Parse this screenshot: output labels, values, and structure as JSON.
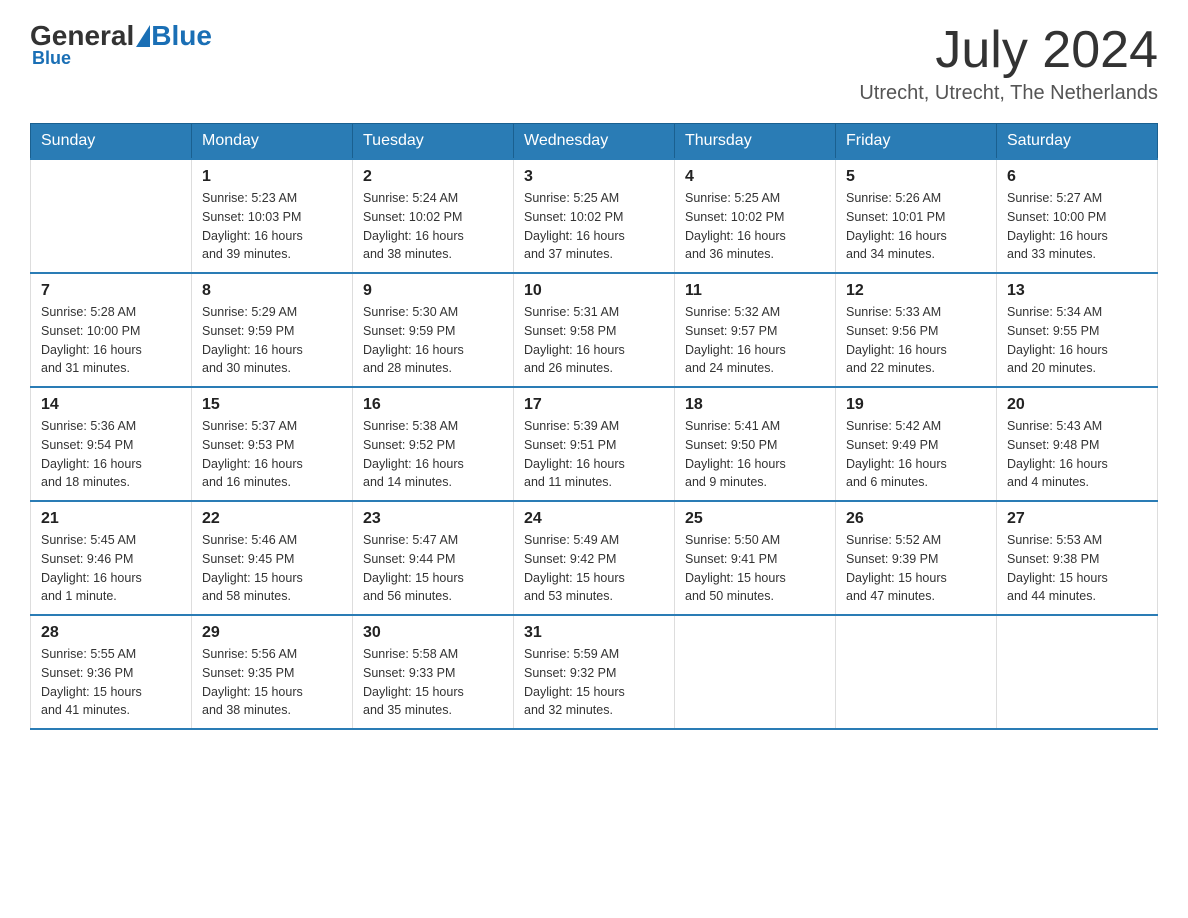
{
  "header": {
    "logo_general": "General",
    "logo_blue": "Blue",
    "month_year": "July 2024",
    "location": "Utrecht, Utrecht, The Netherlands"
  },
  "weekdays": [
    "Sunday",
    "Monday",
    "Tuesday",
    "Wednesday",
    "Thursday",
    "Friday",
    "Saturday"
  ],
  "weeks": [
    [
      {
        "day": "",
        "info": ""
      },
      {
        "day": "1",
        "info": "Sunrise: 5:23 AM\nSunset: 10:03 PM\nDaylight: 16 hours\nand 39 minutes."
      },
      {
        "day": "2",
        "info": "Sunrise: 5:24 AM\nSunset: 10:02 PM\nDaylight: 16 hours\nand 38 minutes."
      },
      {
        "day": "3",
        "info": "Sunrise: 5:25 AM\nSunset: 10:02 PM\nDaylight: 16 hours\nand 37 minutes."
      },
      {
        "day": "4",
        "info": "Sunrise: 5:25 AM\nSunset: 10:02 PM\nDaylight: 16 hours\nand 36 minutes."
      },
      {
        "day": "5",
        "info": "Sunrise: 5:26 AM\nSunset: 10:01 PM\nDaylight: 16 hours\nand 34 minutes."
      },
      {
        "day": "6",
        "info": "Sunrise: 5:27 AM\nSunset: 10:00 PM\nDaylight: 16 hours\nand 33 minutes."
      }
    ],
    [
      {
        "day": "7",
        "info": "Sunrise: 5:28 AM\nSunset: 10:00 PM\nDaylight: 16 hours\nand 31 minutes."
      },
      {
        "day": "8",
        "info": "Sunrise: 5:29 AM\nSunset: 9:59 PM\nDaylight: 16 hours\nand 30 minutes."
      },
      {
        "day": "9",
        "info": "Sunrise: 5:30 AM\nSunset: 9:59 PM\nDaylight: 16 hours\nand 28 minutes."
      },
      {
        "day": "10",
        "info": "Sunrise: 5:31 AM\nSunset: 9:58 PM\nDaylight: 16 hours\nand 26 minutes."
      },
      {
        "day": "11",
        "info": "Sunrise: 5:32 AM\nSunset: 9:57 PM\nDaylight: 16 hours\nand 24 minutes."
      },
      {
        "day": "12",
        "info": "Sunrise: 5:33 AM\nSunset: 9:56 PM\nDaylight: 16 hours\nand 22 minutes."
      },
      {
        "day": "13",
        "info": "Sunrise: 5:34 AM\nSunset: 9:55 PM\nDaylight: 16 hours\nand 20 minutes."
      }
    ],
    [
      {
        "day": "14",
        "info": "Sunrise: 5:36 AM\nSunset: 9:54 PM\nDaylight: 16 hours\nand 18 minutes."
      },
      {
        "day": "15",
        "info": "Sunrise: 5:37 AM\nSunset: 9:53 PM\nDaylight: 16 hours\nand 16 minutes."
      },
      {
        "day": "16",
        "info": "Sunrise: 5:38 AM\nSunset: 9:52 PM\nDaylight: 16 hours\nand 14 minutes."
      },
      {
        "day": "17",
        "info": "Sunrise: 5:39 AM\nSunset: 9:51 PM\nDaylight: 16 hours\nand 11 minutes."
      },
      {
        "day": "18",
        "info": "Sunrise: 5:41 AM\nSunset: 9:50 PM\nDaylight: 16 hours\nand 9 minutes."
      },
      {
        "day": "19",
        "info": "Sunrise: 5:42 AM\nSunset: 9:49 PM\nDaylight: 16 hours\nand 6 minutes."
      },
      {
        "day": "20",
        "info": "Sunrise: 5:43 AM\nSunset: 9:48 PM\nDaylight: 16 hours\nand 4 minutes."
      }
    ],
    [
      {
        "day": "21",
        "info": "Sunrise: 5:45 AM\nSunset: 9:46 PM\nDaylight: 16 hours\nand 1 minute."
      },
      {
        "day": "22",
        "info": "Sunrise: 5:46 AM\nSunset: 9:45 PM\nDaylight: 15 hours\nand 58 minutes."
      },
      {
        "day": "23",
        "info": "Sunrise: 5:47 AM\nSunset: 9:44 PM\nDaylight: 15 hours\nand 56 minutes."
      },
      {
        "day": "24",
        "info": "Sunrise: 5:49 AM\nSunset: 9:42 PM\nDaylight: 15 hours\nand 53 minutes."
      },
      {
        "day": "25",
        "info": "Sunrise: 5:50 AM\nSunset: 9:41 PM\nDaylight: 15 hours\nand 50 minutes."
      },
      {
        "day": "26",
        "info": "Sunrise: 5:52 AM\nSunset: 9:39 PM\nDaylight: 15 hours\nand 47 minutes."
      },
      {
        "day": "27",
        "info": "Sunrise: 5:53 AM\nSunset: 9:38 PM\nDaylight: 15 hours\nand 44 minutes."
      }
    ],
    [
      {
        "day": "28",
        "info": "Sunrise: 5:55 AM\nSunset: 9:36 PM\nDaylight: 15 hours\nand 41 minutes."
      },
      {
        "day": "29",
        "info": "Sunrise: 5:56 AM\nSunset: 9:35 PM\nDaylight: 15 hours\nand 38 minutes."
      },
      {
        "day": "30",
        "info": "Sunrise: 5:58 AM\nSunset: 9:33 PM\nDaylight: 15 hours\nand 35 minutes."
      },
      {
        "day": "31",
        "info": "Sunrise: 5:59 AM\nSunset: 9:32 PM\nDaylight: 15 hours\nand 32 minutes."
      },
      {
        "day": "",
        "info": ""
      },
      {
        "day": "",
        "info": ""
      },
      {
        "day": "",
        "info": ""
      }
    ]
  ]
}
